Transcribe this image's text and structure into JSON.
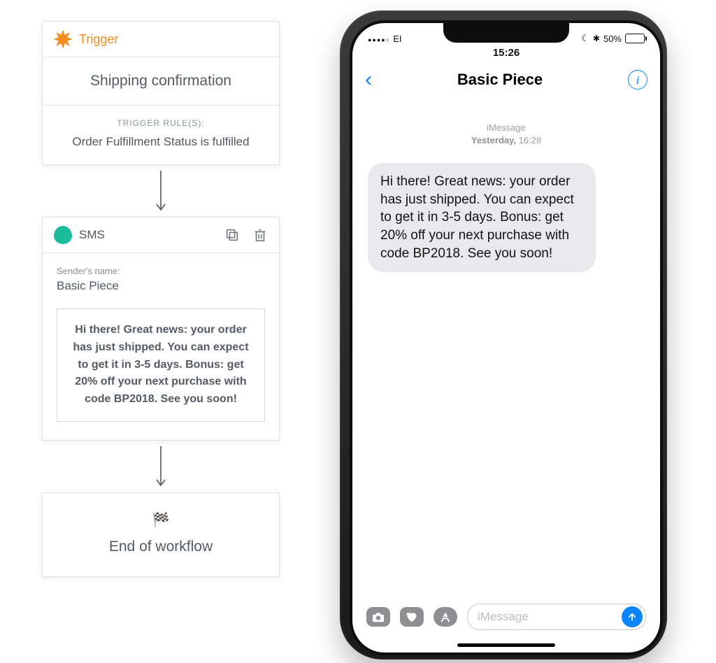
{
  "workflow": {
    "trigger": {
      "header_label": "Trigger",
      "title": "Shipping confirmation",
      "rules_label": "TRIGGER RULE(S):",
      "rule_text": "Order Fulfillment Status is fulfilled"
    },
    "sms": {
      "header_label": "SMS",
      "sender_label": "Sender's name:",
      "sender_name": "Basic Piece",
      "message_text": "Hi there! Great news: your order has just shipped. You can expect to get it in 3-5 days. Bonus: get 20% off your next purchase with code BP2018. See you soon!"
    },
    "end": {
      "label": "End of workflow"
    }
  },
  "phone": {
    "status": {
      "carrier": "EI",
      "time": "15:26",
      "battery_pct": "50%"
    },
    "nav": {
      "title": "Basic Piece"
    },
    "thread_meta": {
      "line1": "iMessage",
      "day": "Yesterday,",
      "time": "16:28"
    },
    "bubble_text": "Hi there! Great news: your order has just shipped. You can expect to get it in 3-5 days. Bonus: get 20% off your next purchase with code BP2018. See you soon!",
    "compose": {
      "placeholder": "iMessage"
    }
  }
}
